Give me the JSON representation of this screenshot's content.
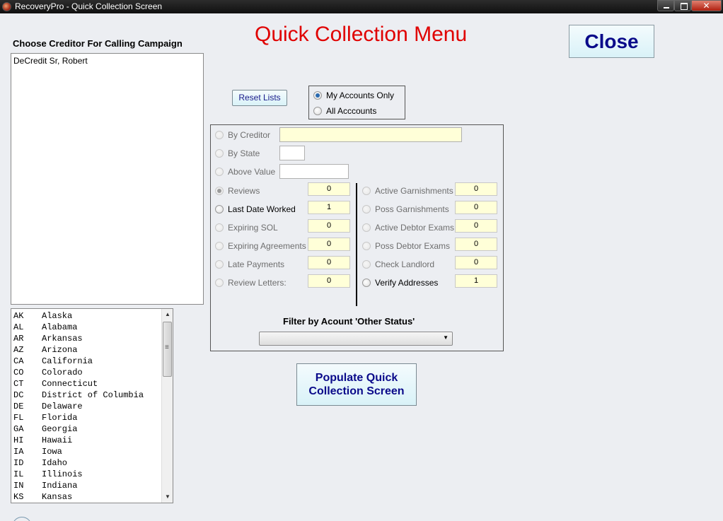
{
  "window": {
    "title": "RecoveryPro - Quick Collection Screen"
  },
  "creditor_list": {
    "heading": "Choose Creditor For Calling Campaign",
    "items": [
      "DeCredit Sr, Robert"
    ]
  },
  "states": [
    {
      "code": "AK",
      "name": "Alaska"
    },
    {
      "code": "AL",
      "name": "Alabama"
    },
    {
      "code": "AR",
      "name": "Arkansas"
    },
    {
      "code": "AZ",
      "name": "Arizona"
    },
    {
      "code": "CA",
      "name": "California"
    },
    {
      "code": "CO",
      "name": "Colorado"
    },
    {
      "code": "CT",
      "name": "Connecticut"
    },
    {
      "code": "DC",
      "name": "District of Columbia"
    },
    {
      "code": "DE",
      "name": "Delaware"
    },
    {
      "code": "FL",
      "name": "Florida"
    },
    {
      "code": "GA",
      "name": "Georgia"
    },
    {
      "code": "HI",
      "name": "Hawaii"
    },
    {
      "code": "IA",
      "name": "Iowa"
    },
    {
      "code": "ID",
      "name": "Idaho"
    },
    {
      "code": "IL",
      "name": "Illinois"
    },
    {
      "code": "IN",
      "name": "Indiana"
    },
    {
      "code": "KS",
      "name": "Kansas"
    }
  ],
  "main_title": "Quick Collection Menu",
  "close_label": "Close",
  "reset_label": "Reset Lists",
  "account_scope": {
    "my_accounts": "My Accounts Only",
    "all_accounts": "All Acccounts",
    "selected": "my_accounts"
  },
  "filters": {
    "by_creditor": {
      "label": "By Creditor",
      "value": ""
    },
    "by_state": {
      "label": "By State",
      "value": ""
    },
    "above_value": {
      "label": "Above Value",
      "value": ""
    },
    "left": [
      {
        "label": "Reviews",
        "value": "0"
      },
      {
        "label": "Last Date Worked",
        "value": "1"
      },
      {
        "label": "Expiring SOL",
        "value": "0"
      },
      {
        "label": "Expiring Agreements",
        "value": "0"
      },
      {
        "label": "Late Payments",
        "value": "0"
      },
      {
        "label": "Review Letters:",
        "value": "0"
      }
    ],
    "right": [
      {
        "label": "Active Garnishments",
        "value": "0"
      },
      {
        "label": "Poss Garnishments",
        "value": "0"
      },
      {
        "label": "Active Debtor Exams",
        "value": "0"
      },
      {
        "label": "Poss Debtor Exams",
        "value": "0"
      },
      {
        "label": "Check Landlord",
        "value": "0"
      },
      {
        "label": "Verify Addresses",
        "value": "1"
      }
    ],
    "other_status_label": "Filter by Acount 'Other Status'",
    "other_status_value": ""
  },
  "populate_label_line1": "Populate Quick",
  "populate_label_line2": "Collection Screen"
}
